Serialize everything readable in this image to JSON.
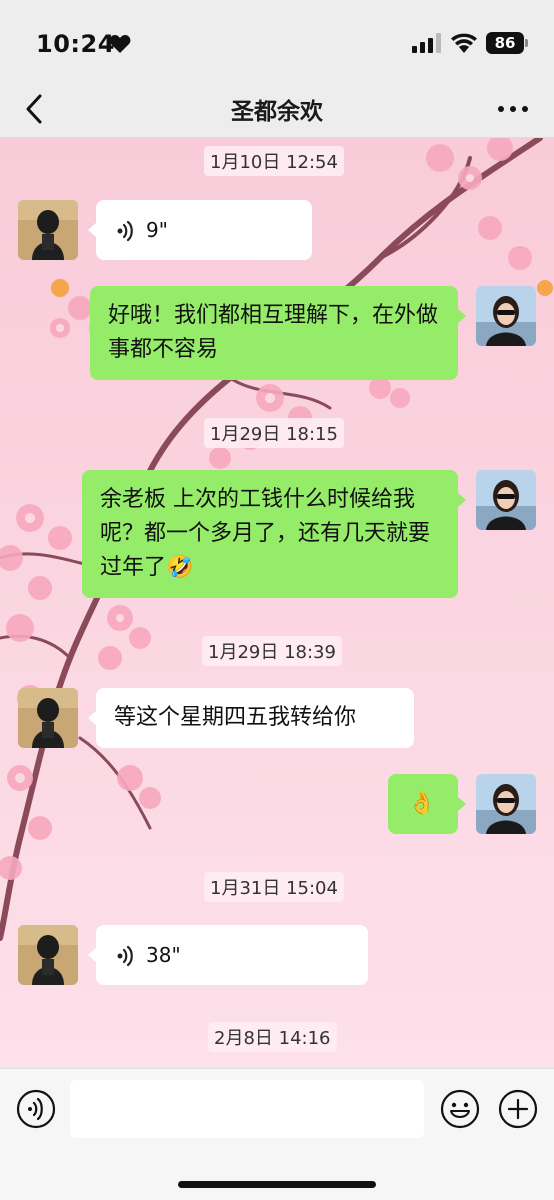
{
  "status": {
    "time": "10:24",
    "battery": "86"
  },
  "nav": {
    "title": "圣都余欢"
  },
  "messages": {
    "ts1": "1月10日 12:54",
    "m1_voice": "9\"",
    "m2_text": "好哦！我们都相互理解下，在外做事都不容易",
    "ts2": "1月29日 18:15",
    "m3_text": "余老板 上次的工钱什么时候给我呢？都一个多月了，还有几天就要过年了",
    "m3_emoji": "🤣",
    "ts3": "1月29日 18:39",
    "m4_text": "等这个星期四五我转给你",
    "m5_emoji": "👌",
    "ts4": "1月31日 15:04",
    "m6_voice": "38\"",
    "ts5": "2月8日 14:16"
  },
  "colors": {
    "green_bubble": "#95ec69",
    "white_bubble": "#ffffff",
    "bar_bg": "#ededed"
  },
  "icons": [
    "heart-icon",
    "signal-icon",
    "wifi-icon",
    "back-icon",
    "more-icon",
    "voice-icon",
    "emoji-icon",
    "plus-icon"
  ]
}
